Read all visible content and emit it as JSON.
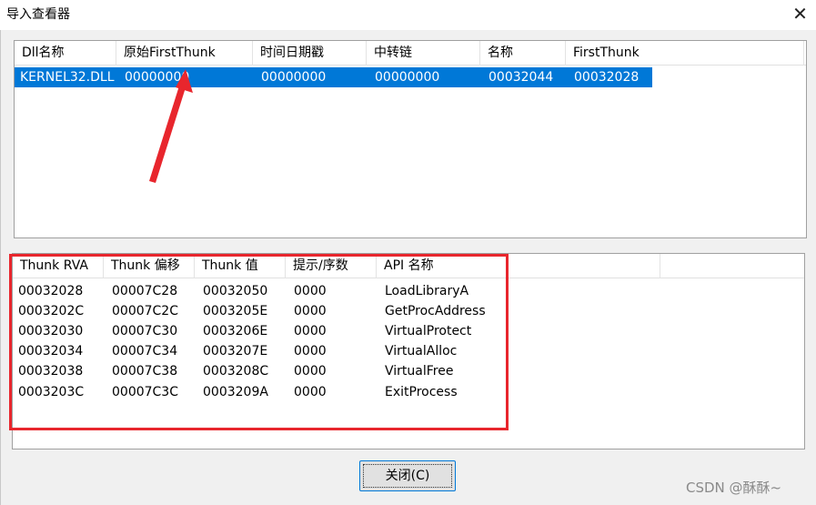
{
  "window": {
    "title": "导入查看器",
    "close_glyph": "✕"
  },
  "modules": {
    "columns": [
      "Dll名称",
      "原始FirstThunk",
      "时间日期戳",
      "中转链",
      "名称",
      "FirstThunk"
    ],
    "rows": [
      [
        "KERNEL32.DLL",
        "00000000",
        "00000000",
        "00000000",
        "00032044",
        "00032028"
      ]
    ],
    "selected_row": 0
  },
  "thunks": {
    "columns": [
      "Thunk RVA",
      "Thunk 偏移",
      "Thunk 值",
      "提示/序数",
      "API 名称"
    ],
    "rows": [
      [
        "00032028",
        "00007C28",
        "00032050",
        "0000",
        "LoadLibraryA"
      ],
      [
        "0003202C",
        "00007C2C",
        "0003205E",
        "0000",
        "GetProcAddress"
      ],
      [
        "00032030",
        "00007C30",
        "0003206E",
        "0000",
        "VirtualProtect"
      ],
      [
        "00032034",
        "00007C34",
        "0003207E",
        "0000",
        "VirtualAlloc"
      ],
      [
        "00032038",
        "00007C38",
        "0003208C",
        "0000",
        "VirtualFree"
      ],
      [
        "0003203C",
        "00007C3C",
        "0003209A",
        "0000",
        "ExitProcess"
      ]
    ]
  },
  "buttons": {
    "close_label": "关闭(C)"
  },
  "watermark": "CSDN @酥酥~",
  "colors": {
    "selection": "#0078d7",
    "annotation": "#e8262d"
  }
}
